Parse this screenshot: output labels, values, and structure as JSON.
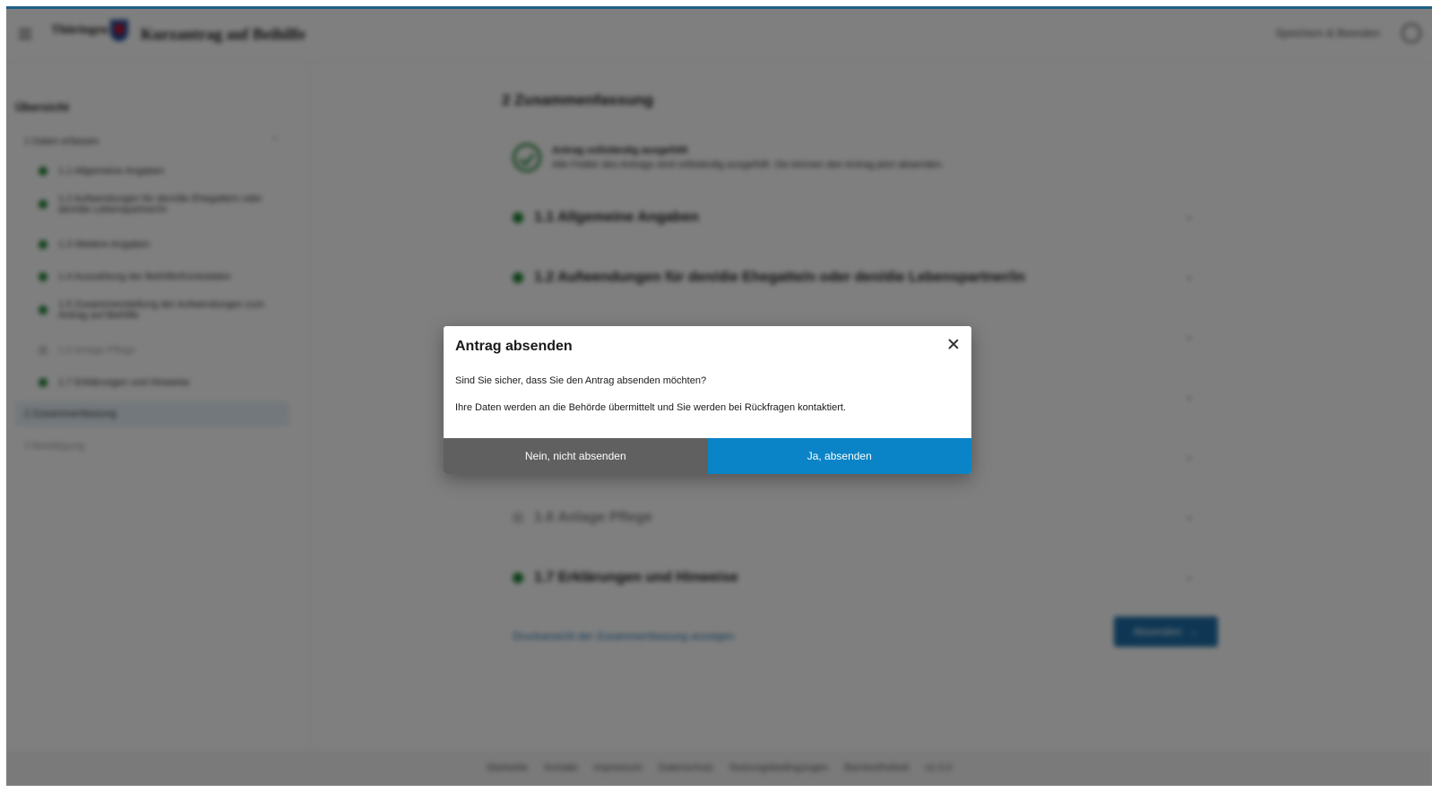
{
  "header": {
    "logo_text": "Thüringen",
    "app_title": "Kurzantrag auf Beihilfe",
    "save_exit_label": "Speichern & Beenden",
    "menu_icon": "hamburger-icon",
    "user_icon": "user-icon"
  },
  "sidebar": {
    "heading": "Übersicht",
    "section_1": "1 Daten erfassen",
    "items": [
      {
        "label": "1.1 Allgemeine Angaben",
        "status": "complete"
      },
      {
        "label": "1.2 Aufwendungen für den/die Ehegatte/n oder den/die Lebenspartner/in",
        "status": "complete"
      },
      {
        "label": "1.3 Weitere Angaben",
        "status": "complete"
      },
      {
        "label": "1.4 Auszahlung der Beihilfe/Kontodaten",
        "status": "complete"
      },
      {
        "label": "1.5 Zusammenstellung der Aufwendungen zum Antrag auf Beihilfe",
        "status": "complete"
      },
      {
        "label": "1.6 Anlage Pflege",
        "status": "pending"
      },
      {
        "label": "1.7 Erklärungen und Hinweise",
        "status": "complete"
      }
    ],
    "section_2": "2 Zusammenfassung",
    "section_3": "3 Bestätigung"
  },
  "main": {
    "title": "2 Zusammenfassung",
    "success_title": "Antrag vollständig ausgefüllt",
    "success_text": "Alle Felder des Antrags sind vollständig ausgefüllt. Sie können den Antrag jetzt absenden.",
    "sections": [
      {
        "label": "1.1 Allgemeine Angaben",
        "status": "complete"
      },
      {
        "label": "1.2 Aufwendungen für den/die Ehegatte/n oder den/die Lebenspartner/in",
        "status": "complete"
      },
      {
        "label": "",
        "status": "complete"
      },
      {
        "label": "",
        "status": "complete"
      },
      {
        "label": "",
        "status": "complete"
      },
      {
        "label": "1.6 Anlage Pflege",
        "status": "pending"
      },
      {
        "label": "1.7 Erklärungen und Hinweise",
        "status": "complete"
      }
    ],
    "print_link": "Druckansicht der Zusammenfassung anzeigen",
    "next_button": "Absenden"
  },
  "footer": {
    "links": [
      "Startseite",
      "Kontakt",
      "Impressum",
      "Datenschutz",
      "Nutzungsbedingungen",
      "Barrierefreiheit",
      "v1.0.0"
    ]
  },
  "modal": {
    "title": "Antrag absenden",
    "line1": "Sind Sie sicher, dass Sie den Antrag absenden möchten?",
    "line2": "Ihre Daten werden an die Behörde übermittelt und Sie werden bei Rückfragen kontaktiert.",
    "cancel_label": "Nein, nicht absenden",
    "confirm_label": "Ja, absenden",
    "close_icon": "close-icon"
  },
  "colors": {
    "accent": "#0a84c6",
    "secondary_button": "#606060",
    "success": "#1a7f2e",
    "header_border": "#1e5f84"
  }
}
